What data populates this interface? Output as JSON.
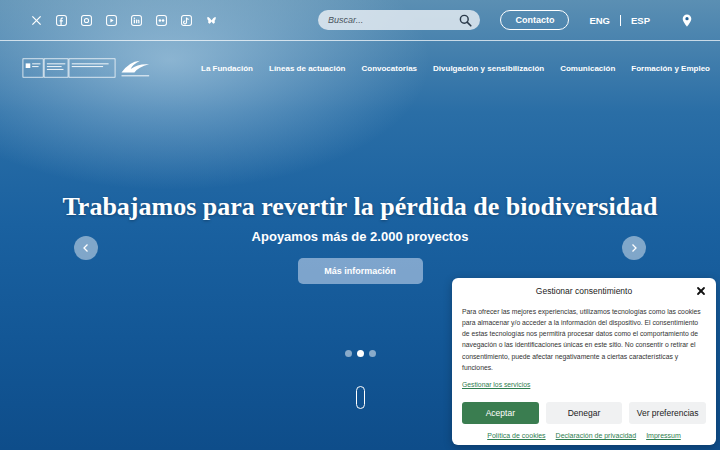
{
  "header": {
    "search": {
      "placeholder": "Buscar..."
    },
    "contact_button": "Contacto",
    "languages": [
      "ENG",
      "ESP"
    ]
  },
  "nav": {
    "items": [
      "La Fundación",
      "Líneas de actuación",
      "Convocatorias",
      "Divulgación y sensibilización",
      "Comunicación",
      "Formación y Empleo"
    ]
  },
  "hero": {
    "title": "Trabajamos para revertir la pérdida de biodiversidad",
    "subtitle": "Apoyamos más de 2.000 proyectos",
    "button": "Más información",
    "slides": [
      {
        "selected": false
      },
      {
        "selected": true
      },
      {
        "selected": false
      }
    ]
  },
  "cookie_dialog": {
    "title": "Gestionar consentimiento",
    "body": "Para ofrecer las mejores experiencias, utilizamos tecnologías como las cookies para almacenar y/o acceder a la información del dispositivo. El consentimiento de estas tecnologías nos permitirá procesar datos como el comportamiento de navegación o las identificaciones únicas en este sitio. No consentir o retirar el consentimiento, puede afectar negativamente a ciertas características y funciones.",
    "manage_link": "Gestionar los servicios",
    "buttons": [
      {
        "label": "Aceptar",
        "kind": "primary"
      },
      {
        "label": "Denegar",
        "kind": "secondary"
      },
      {
        "label": "Ver preferencias",
        "kind": "secondary"
      }
    ],
    "links": [
      "Política de cookies",
      "Declaración de privacidad",
      "Impressum"
    ]
  }
}
